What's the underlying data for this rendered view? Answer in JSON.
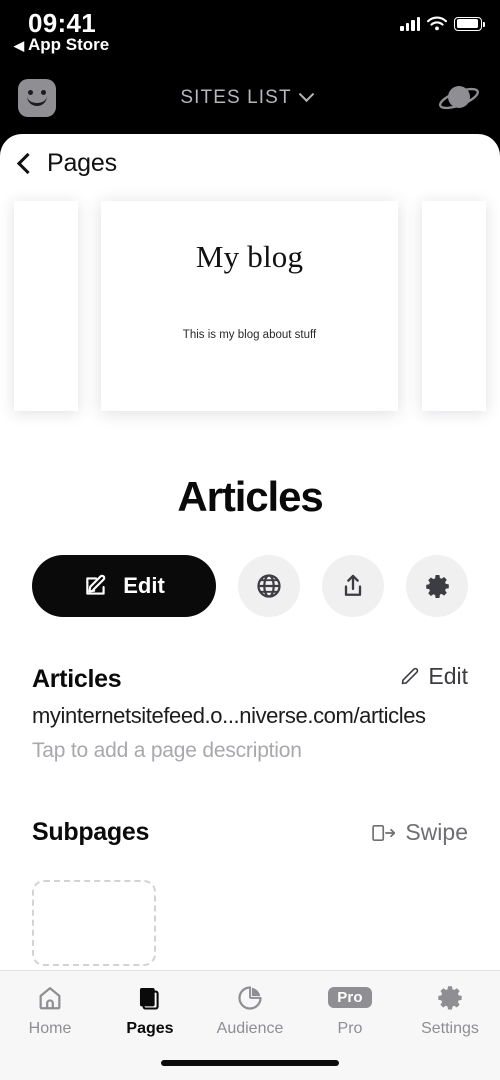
{
  "status_bar": {
    "time": "09:41",
    "back_label": "App Store",
    "back_icon": "triangle-left-icon",
    "signal_icon": "cellular-signal-icon",
    "wifi_icon": "wifi-icon",
    "battery_icon": "battery-icon"
  },
  "app_bar": {
    "avatar_icon": "smiley-avatar-icon",
    "title": "SITES LIST",
    "dropdown_icon": "chevron-down-icon",
    "planet_icon": "planet-icon"
  },
  "nav": {
    "back_icon": "chevron-left-icon",
    "title": "Pages"
  },
  "preview": {
    "site_title": "My blog",
    "site_subtitle": "This is my blog about stuff"
  },
  "page": {
    "heading": "Articles"
  },
  "actions": {
    "edit_label": "Edit",
    "edit_icon": "square-pencil-icon",
    "globe_icon": "globe-icon",
    "share_icon": "share-upload-icon",
    "settings_icon": "gear-icon"
  },
  "detail": {
    "title": "Articles",
    "edit_label": "Edit",
    "edit_icon": "pencil-icon",
    "url": "myinternetsitefeed.o...niverse.com/articles",
    "description_placeholder": "Tap to add a page description"
  },
  "subpages": {
    "title": "Subpages",
    "swipe_label": "Swipe",
    "swipe_icon": "swipe-right-icon"
  },
  "tabbar": {
    "items": [
      {
        "label": "Home",
        "icon": "home-icon",
        "active": false
      },
      {
        "label": "Pages",
        "icon": "pages-icon",
        "active": true
      },
      {
        "label": "Audience",
        "icon": "pie-chart-icon",
        "active": false
      },
      {
        "label": "Pro",
        "icon": "pro-badge-icon",
        "active": false
      },
      {
        "label": "Settings",
        "icon": "gear-icon",
        "active": false
      }
    ]
  },
  "colors": {
    "accent": "#0a0a0a",
    "muted": "#8e8e93",
    "chrome": "#000000",
    "surface": "#ffffff",
    "tabbar": "#f7f7f8"
  }
}
